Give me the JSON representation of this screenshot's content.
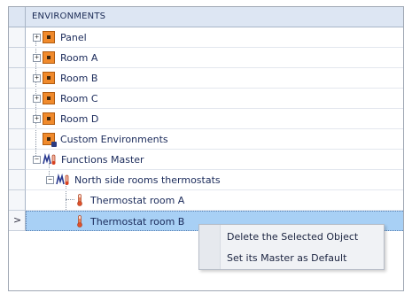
{
  "grid": {
    "header": "ENVIRONMENTS"
  },
  "tree": [
    {
      "label": "Panel",
      "icon": "environment-icon",
      "expander": "+"
    },
    {
      "label": "Room A",
      "icon": "environment-icon",
      "expander": "+"
    },
    {
      "label": "Room B",
      "icon": "environment-icon",
      "expander": "+"
    },
    {
      "label": "Room C",
      "icon": "environment-icon",
      "expander": "+"
    },
    {
      "label": "Room D",
      "icon": "environment-icon",
      "expander": "+"
    },
    {
      "label": "Custom Environments",
      "icon": "custom-environment-icon"
    },
    {
      "label": "Functions Master",
      "icon": "functions-master-icon",
      "expander": "−"
    },
    {
      "label": "North side rooms thermostats",
      "icon": "functions-master-icon",
      "expander": "−"
    },
    {
      "label": "Thermostat room A",
      "icon": "thermometer-icon"
    },
    {
      "label": "Thermostat room B",
      "icon": "thermometer-icon",
      "selected": true
    }
  ],
  "row_indicator": ">",
  "context_menu": {
    "items": [
      "Delete the Selected Object",
      "Set its Master as Default"
    ]
  },
  "colors": {
    "selection": "#a8d0f5",
    "header_bg": "#dde6f3",
    "env_icon": "#f08a2c"
  }
}
